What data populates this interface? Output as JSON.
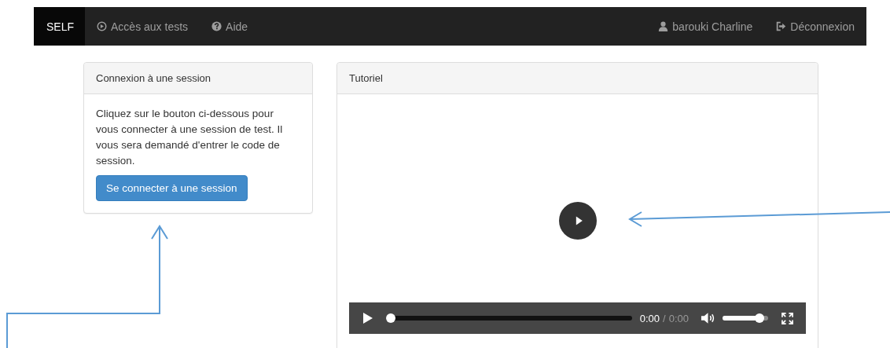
{
  "navbar": {
    "brand": "SELF",
    "left_items": [
      {
        "kind": "tests",
        "label": "Accès aux tests"
      },
      {
        "kind": "help",
        "label": "Aide"
      }
    ],
    "right_items": [
      {
        "kind": "user",
        "label": "barouki Charline"
      },
      {
        "kind": "logout",
        "label": "Déconnexion"
      }
    ]
  },
  "session_panel": {
    "title": "Connexion à une session",
    "text": "Cliquez sur le bouton ci-dessous pour vous connecter à une session de test. Il vous sera demandé d'entrer le code de session.",
    "button": "Se connecter à une session"
  },
  "tutorial_panel": {
    "title": "Tutoriel",
    "video": {
      "progress": {
        "level": 0
      },
      "time_current": "0:00",
      "time_separator": "/",
      "time_total": "0:00",
      "volume": {
        "level": 0.9
      }
    }
  }
}
